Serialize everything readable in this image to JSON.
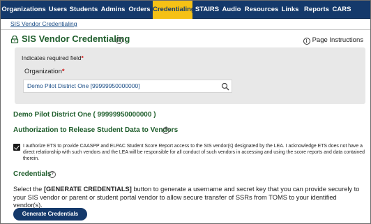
{
  "nav": {
    "items": [
      {
        "label": "Organizations"
      },
      {
        "label": "Users"
      },
      {
        "label": "Students"
      },
      {
        "label": "Admins"
      },
      {
        "label": "Orders"
      },
      {
        "label": "Credentialing",
        "active": true
      },
      {
        "label": "STAIRS"
      },
      {
        "label": "Audio"
      },
      {
        "label": "Resources"
      },
      {
        "label": "Links"
      },
      {
        "label": "Reports"
      },
      {
        "label": "CARS"
      }
    ]
  },
  "subnav": {
    "link": "SIS Vendor Credentialing"
  },
  "page": {
    "title": "SIS Vendor Credentialing",
    "title_help_glyph": "?",
    "instructions_glyph": "i",
    "instructions": "Page Instructions"
  },
  "form": {
    "required_note": "Indicates required field",
    "required_marker": "*",
    "org_label": "Organization",
    "org_value": "Demo Pilot District One [99999950000000]"
  },
  "org_heading": "Demo Pilot District One ( 99999950000000 )",
  "authorization": {
    "heading": "Authorization to Release Student Data to Vendors",
    "help_glyph": "?",
    "checked": true,
    "text": "I authorize ETS to provide CAASPP and ELPAC Student Score Report access to the SIS vendor(s) designated by the LEA. I acknowledge ETS does not have a direct relationship with such vendors and the LEA will be responsible for all conduct of such vendors in accessing and using the score reports and data contained therein."
  },
  "credentials": {
    "heading": "Credentials",
    "help_glyph": "?",
    "text_before": "Select the ",
    "text_bold": "[GENERATE CREDENTIALS]",
    "text_after": " button to generate a username and secret key that you can provide securely to your SIS vendor or parent or student portal vendor to allow secure transfer of SSRs from TOMS to your identified vendor(s).",
    "button": "Generate Credentials"
  },
  "colors": {
    "nav_bg": "#14396b",
    "active_tab": "#f5c116",
    "heading_green": "#1f5e2c",
    "link_blue": "#1a4d86",
    "required_red": "#cc1111"
  }
}
